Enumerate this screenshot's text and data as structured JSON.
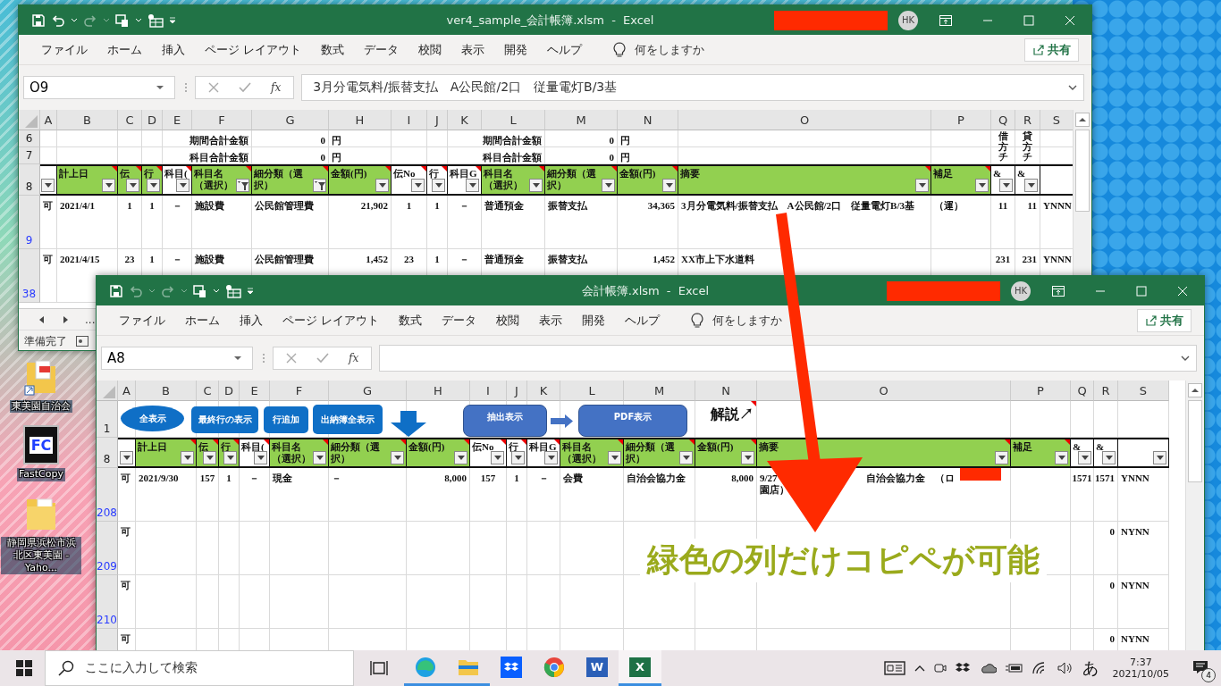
{
  "desktop_icons": [
    {
      "kind": "pdf-folder",
      "label": "東美園自治会"
    },
    {
      "kind": "app",
      "logo": "FC",
      "label": "FastCopy"
    },
    {
      "kind": "folder",
      "label": "静岡県浜松市浜北区東美園 - Yaho..."
    }
  ],
  "windows": [
    {
      "title": "ver4_sample_会計帳簿.xlsm - Excel",
      "undo_enabled": true,
      "user": "HK",
      "menu": [
        "ファイル",
        "ホーム",
        "挿入",
        "ページ レイアウト",
        "数式",
        "データ",
        "校閲",
        "表示",
        "開発",
        "ヘルプ"
      ],
      "tell_me": "何をしますか",
      "share": "共有",
      "name_box": "O9",
      "function_label": "fx",
      "formula": "3月分電気料/振替支払　A公民館/2口　従量電灯B/3基",
      "columns": [
        "A",
        "B",
        "C",
        "D",
        "E",
        "F",
        "G",
        "H",
        "I",
        "J",
        "K",
        "L",
        "M",
        "N",
        "O",
        "P",
        "Q",
        "R",
        "S"
      ],
      "rows": [
        {
          "number": "6",
          "filtered": false,
          "kind": "summary",
          "cells": [
            null,
            null,
            null,
            null,
            "期間合計金額",
            null,
            "0",
            "円",
            null,
            null,
            "期間合計金額",
            null,
            "0",
            "円",
            null,
            null,
            "借方チ",
            "貸方チ",
            null
          ]
        },
        {
          "number": "7",
          "filtered": false,
          "kind": "summary",
          "cells": [
            null,
            null,
            null,
            null,
            "科目合計金額",
            null,
            "0",
            "円",
            null,
            null,
            "科目合計金額",
            null,
            "0",
            "円",
            null,
            null,
            null,
            null,
            null
          ]
        },
        {
          "number": "8",
          "filtered": false,
          "kind": "header",
          "cells": [
            {
              "green": false,
              "note": false,
              "filter_applied": false
            },
            {
              "text": "計上日",
              "green": true,
              "note": true,
              "filter_applied": false
            },
            {
              "text": "伝",
              "green": true,
              "note": true,
              "filter_applied": false
            },
            {
              "text": "行",
              "green": true,
              "note": true,
              "filter_applied": false
            },
            {
              "text": "科目(",
              "green": false,
              "note": true,
              "filter_applied": false
            },
            {
              "text": "科目名（選択）",
              "green": true,
              "note": true,
              "filter_applied": true
            },
            {
              "text": "細分類（選択）",
              "green": true,
              "note": true,
              "filter_applied": true
            },
            {
              "text": "金額(円)",
              "green": true,
              "note": true,
              "filter_applied": false
            },
            {
              "text": "伝No",
              "green": false,
              "note": true,
              "filter_applied": false
            },
            {
              "text": "行",
              "green": false,
              "note": true,
              "filter_applied": false
            },
            {
              "text": "科目G",
              "green": false,
              "note": true,
              "filter_applied": false
            },
            {
              "text": "科目名（選択）",
              "green": true,
              "note": true,
              "filter_applied": false
            },
            {
              "text": "細分類（選択）",
              "green": true,
              "note": true,
              "filter_applied": false
            },
            {
              "text": "金額(円)",
              "green": true,
              "note": true,
              "filter_applied": false
            },
            {
              "text": "摘要",
              "green": true,
              "note": true,
              "filter_applied": false
            },
            {
              "text": "補足",
              "green": true,
              "note": true,
              "filter_applied": false
            },
            {
              "text": "&",
              "green": false,
              "note": false,
              "filter_applied": false
            },
            {
              "text": "&",
              "green": false,
              "note": false,
              "filter_applied": false
            },
            null
          ]
        },
        {
          "number": "9",
          "filtered": true,
          "cells": [
            "可",
            "2021/4/1",
            "1",
            "1",
            "－",
            "施設費",
            "公民館管理費",
            "21,902",
            "1",
            "1",
            "－",
            "普通預金",
            "振替支払",
            "34,365",
            "3月分電気料/振替支払　A公民館/2口　従量電灯B/3基",
            "（運）",
            "11",
            "11",
            "YNNN"
          ]
        },
        {
          "number": "38",
          "filtered": true,
          "cells": [
            "可",
            "2021/4/15",
            "23",
            "1",
            "－",
            "施設費",
            "公民館管理費",
            "1,452",
            "23",
            "1",
            "－",
            "普通預金",
            "振替支払",
            "1,452",
            "XX市上下水道料",
            null,
            "231",
            "231",
            "YNNN"
          ]
        }
      ],
      "sheet_nav": "...",
      "status": "準備完了"
    },
    {
      "title": "会計帳簿.xlsm - Excel",
      "undo_enabled": false,
      "user": "HK",
      "menu": [
        "ファイル",
        "ホーム",
        "挿入",
        "ページ レイアウト",
        "数式",
        "データ",
        "校閲",
        "表示",
        "開発",
        "ヘルプ"
      ],
      "tell_me": "何をしますか",
      "share": "共有",
      "name_box": "A8",
      "function_label": "fx",
      "columns": [
        "A",
        "B",
        "C",
        "D",
        "E",
        "F",
        "G",
        "H",
        "I",
        "J",
        "K",
        "L",
        "M",
        "N",
        "O",
        "P",
        "Q",
        "R",
        "S"
      ],
      "rows": [
        {
          "number": "1",
          "filtered": false,
          "kind": "buttons",
          "cells": [
            null,
            null,
            null,
            null,
            null,
            null,
            null,
            null,
            null,
            null,
            null,
            null,
            null,
            {
              "text": "解説↗",
              "note": true
            },
            null,
            null,
            null,
            null,
            null
          ],
          "shapes": [
            {
              "kind": "ellipse",
              "label": "全表示"
            },
            {
              "kind": "button",
              "label": "最終行の表示"
            },
            {
              "kind": "button",
              "label": "行追加"
            },
            {
              "kind": "button",
              "label": "出納簿全表示"
            },
            {
              "kind": "down-arrow"
            },
            {
              "kind": "panel",
              "label": "抽出表示"
            },
            {
              "kind": "right-arrow"
            },
            {
              "kind": "panel",
              "label": "PDF表示"
            }
          ]
        },
        {
          "number": "8",
          "filtered": false,
          "kind": "header",
          "cells": [
            {
              "green": false,
              "note": false,
              "filter_applied": false
            },
            {
              "text": "計上日",
              "green": true,
              "note": true,
              "filter_applied": false
            },
            {
              "text": "伝",
              "green": true,
              "note": true,
              "filter_applied": false
            },
            {
              "text": "行",
              "green": true,
              "note": true,
              "filter_applied": false
            },
            {
              "text": "科目(",
              "green": false,
              "note": true,
              "filter_applied": false
            },
            {
              "text": "科目名（選択）",
              "green": true,
              "note": true,
              "filter_applied": false
            },
            {
              "text": "細分類（選択）",
              "green": true,
              "note": true,
              "filter_applied": false
            },
            {
              "text": "金額(円)",
              "green": true,
              "note": true,
              "filter_applied": false
            },
            {
              "text": "伝No",
              "green": false,
              "note": true,
              "filter_applied": false
            },
            {
              "text": "行",
              "green": false,
              "note": true,
              "filter_applied": false
            },
            {
              "text": "科目G",
              "green": false,
              "note": true,
              "filter_applied": false
            },
            {
              "text": "科目名（選択）",
              "green": true,
              "note": true,
              "filter_applied": false
            },
            {
              "text": "細分類（選択）",
              "green": true,
              "note": true,
              "filter_applied": false
            },
            {
              "text": "金額(円)",
              "green": true,
              "note": true,
              "filter_applied": false
            },
            {
              "text": "摘要",
              "green": true,
              "note": true,
              "filter_applied": false
            },
            {
              "text": "補足",
              "green": true,
              "note": true,
              "filter_applied": false
            },
            {
              "text": "&",
              "green": false,
              "note": false,
              "filter_applied": false
            },
            {
              "text": "&",
              "green": false,
              "note": false,
              "filter_applied": false
            },
            {
              "green": false,
              "note": false,
              "filter_applied": false
            }
          ]
        },
        {
          "number": "208",
          "filtered": true,
          "cells": [
            "可",
            "2021/9/30",
            "157",
            "1",
            "－",
            "現金",
            "－",
            "8,000",
            "157",
            "1",
            "－",
            "会費",
            "自治会協力金",
            "8,000",
            {
              "lines": [
                "9/27　　　　　　　　　自治会協力金　（ロ",
                "園店）"
              ]
            },
            null,
            "1571",
            "1571",
            "YNNN"
          ]
        },
        {
          "number": "209",
          "filtered": true,
          "cells": [
            "可",
            null,
            null,
            null,
            null,
            null,
            null,
            null,
            null,
            null,
            null,
            null,
            null,
            null,
            null,
            null,
            null,
            "0",
            "NYNN"
          ]
        },
        {
          "number": "210",
          "filtered": true,
          "cells": [
            "可",
            null,
            null,
            null,
            null,
            null,
            null,
            null,
            null,
            null,
            null,
            null,
            null,
            null,
            null,
            null,
            null,
            "0",
            "NYNN"
          ]
        },
        {
          "cells": [
            "可",
            null,
            null,
            null,
            null,
            null,
            null,
            null,
            null,
            null,
            null,
            null,
            null,
            null,
            null,
            null,
            null,
            "0",
            "NYNN"
          ]
        }
      ]
    }
  ],
  "annotation": {
    "text": "緑色の列だけコピペが可能"
  },
  "taskbar": {
    "search": {
      "placeholder": "ここに入力して検索"
    },
    "apps": [
      {
        "kind": "edge",
        "running": true,
        "selected": false
      },
      {
        "kind": "explorer",
        "running": true,
        "selected": false
      },
      {
        "kind": "dropbox",
        "running": false,
        "selected": false
      },
      {
        "kind": "chrome",
        "running": false,
        "selected": false
      },
      {
        "kind": "word",
        "logo": "W",
        "running": false,
        "selected": false
      },
      {
        "kind": "excel",
        "logo": "X",
        "running": true,
        "selected": true
      }
    ],
    "ime": "あ",
    "time": "7:37",
    "date": "2021/10/05",
    "notifications": "4"
  }
}
